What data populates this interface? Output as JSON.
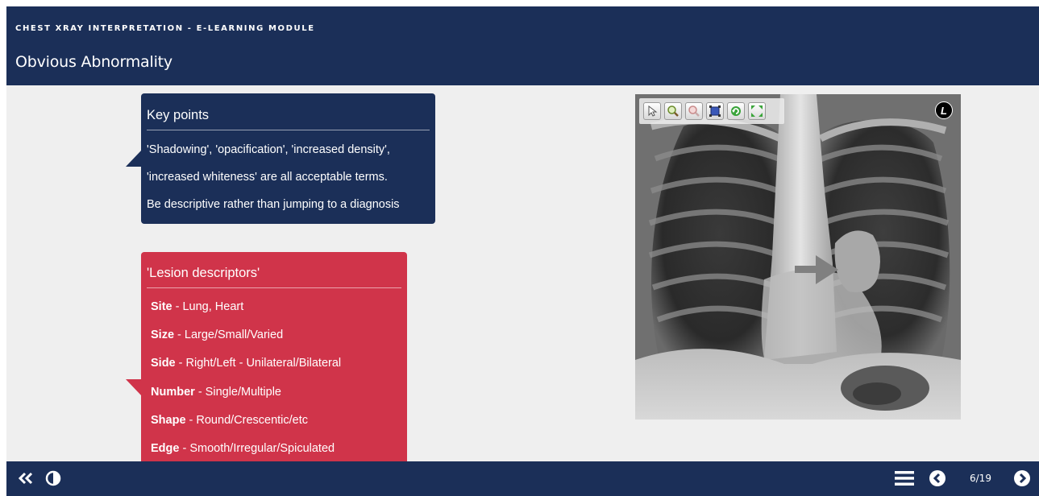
{
  "header": {
    "module_title": "CHEST XRAY INTERPRETATION - E-LEARNING MODULE",
    "page_title": "Obvious Abnormality"
  },
  "key_points": {
    "heading": "Key points",
    "lines": [
      "'Shadowing', 'opacification', 'increased density',",
      "'increased whiteness' are all acceptable terms.",
      "Be descriptive rather than jumping to a diagnosis"
    ]
  },
  "lesion_descriptors": {
    "heading": "'Lesion descriptors'",
    "items": [
      {
        "term": "Site",
        "desc": " - Lung, Heart"
      },
      {
        "term": "Size",
        "desc": " - Large/Small/Varied"
      },
      {
        "term": "Side",
        "desc": " - Right/Left - Unilateral/Bilateral"
      },
      {
        "term": "Number",
        "desc": " - Single/Multiple"
      },
      {
        "term": "Shape",
        "desc": " - Round/Crescentic/etc"
      },
      {
        "term": "Edge",
        "desc": " - Smooth/Irregular/Spiculated"
      }
    ]
  },
  "viewer": {
    "side_marker": "L",
    "tools": [
      "pointer-tool-icon",
      "zoom-in-icon",
      "zoom-out-icon",
      "fit-window-icon",
      "reset-icon",
      "fullscreen-icon"
    ]
  },
  "footer": {
    "page_counter": "6/19",
    "icons": [
      "double-chevron-left-icon",
      "contrast-icon",
      "menu-icon",
      "chevron-left-circle-icon",
      "chevron-right-circle-icon"
    ]
  },
  "colors": {
    "navy": "#1b2f58",
    "red": "#d0344a",
    "background": "#efefef"
  }
}
